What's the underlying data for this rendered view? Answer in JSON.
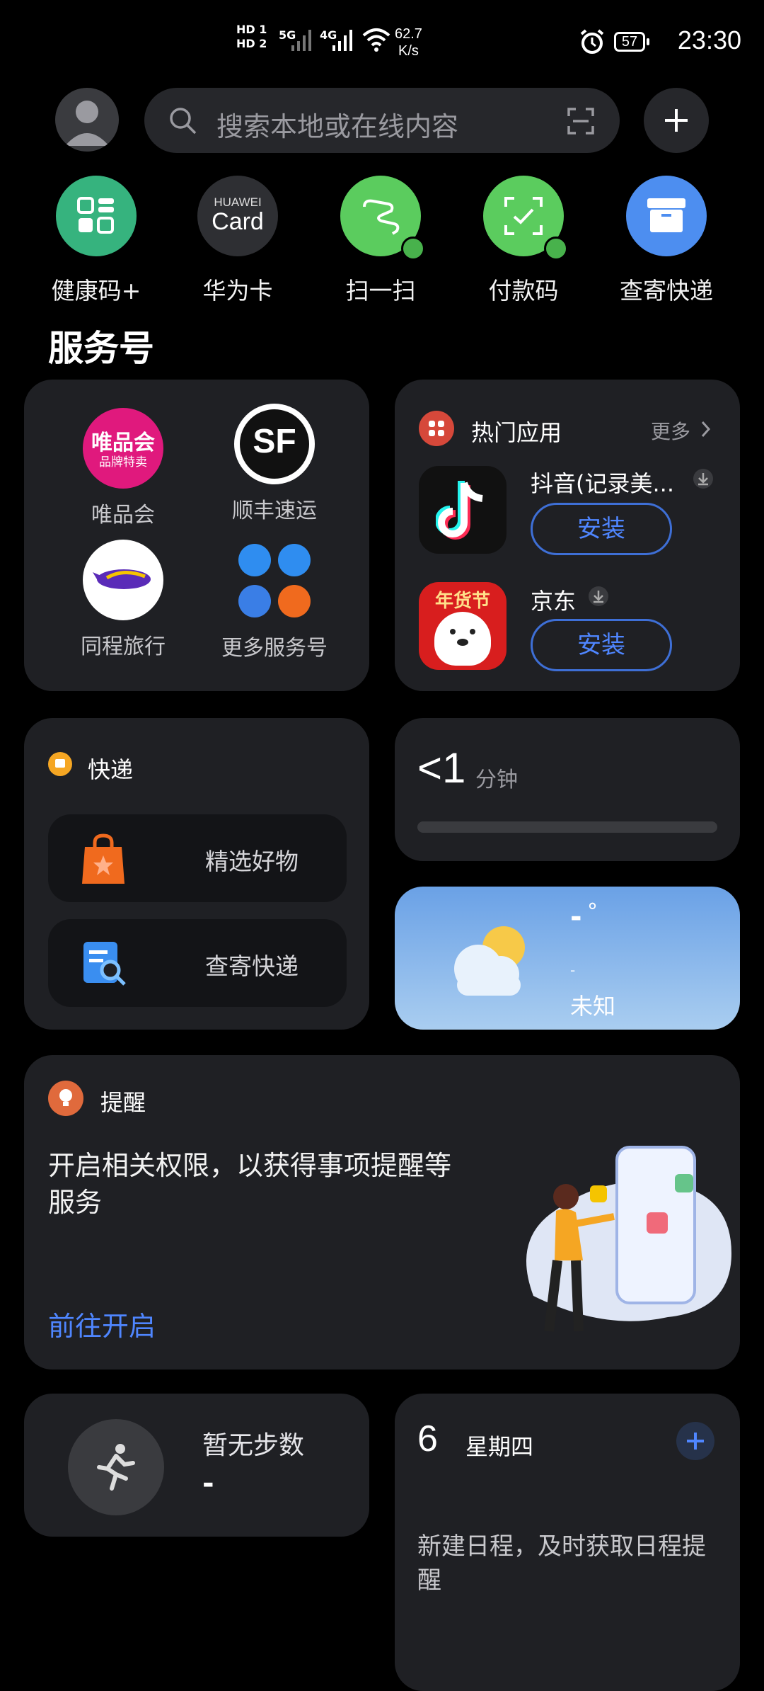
{
  "status_bar": {
    "hd1": "HD 1",
    "hd2": "HD 2",
    "net5g": "5G",
    "net4g": "4G",
    "speed_value": "62.7",
    "speed_unit": "K/s",
    "battery": "57",
    "time": "23:30"
  },
  "search": {
    "placeholder": "搜索本地或在线内容"
  },
  "quick_actions": [
    {
      "label": "健康码+",
      "color": "#36b37e"
    },
    {
      "label": "华为卡",
      "color": "#2e2f33",
      "logo_top": "HUAWEI",
      "logo_bottom": "Card"
    },
    {
      "label": "扫一扫",
      "color": "#5bcc5e"
    },
    {
      "label": "付款码",
      "color": "#5bcc5e"
    },
    {
      "label": "查寄快递",
      "color": "#4d8ef0"
    }
  ],
  "section_title": "服务号",
  "services": {
    "vip": {
      "label": "唯品会",
      "logo_line1": "唯品会",
      "logo_line2": "品牌特卖"
    },
    "sf": {
      "label": "顺丰速运",
      "logo": "SF"
    },
    "tongcheng": {
      "label": "同程旅行"
    },
    "more": {
      "label": "更多服务号"
    }
  },
  "hot_apps": {
    "title": "热门应用",
    "more": "更多",
    "apps": [
      {
        "name": "抖音(记录美...",
        "install": "安装"
      },
      {
        "name": "京东",
        "install": "安装",
        "badge": "年货节"
      }
    ]
  },
  "express": {
    "title": "快递",
    "rows": [
      {
        "label": "精选好物"
      },
      {
        "label": "查寄快递"
      }
    ]
  },
  "commute": {
    "value": "<1",
    "unit": "分钟"
  },
  "weather": {
    "temp": "-",
    "degree": "°",
    "sub": "-",
    "condition": "未知"
  },
  "reminder": {
    "title": "提醒",
    "body": "开启相关权限，以获得事项提醒等服务",
    "action": "前往开启"
  },
  "steps": {
    "title": "暂无步数",
    "value": "-"
  },
  "calendar": {
    "day": "6",
    "weekday": "星期四",
    "body": "新建日程，及时获取日程提醒"
  },
  "colors": {
    "accent": "#4f86ff",
    "card": "#1f2024",
    "weather_top": "#6aa1e6",
    "weather_bottom": "#a9cdf0"
  }
}
